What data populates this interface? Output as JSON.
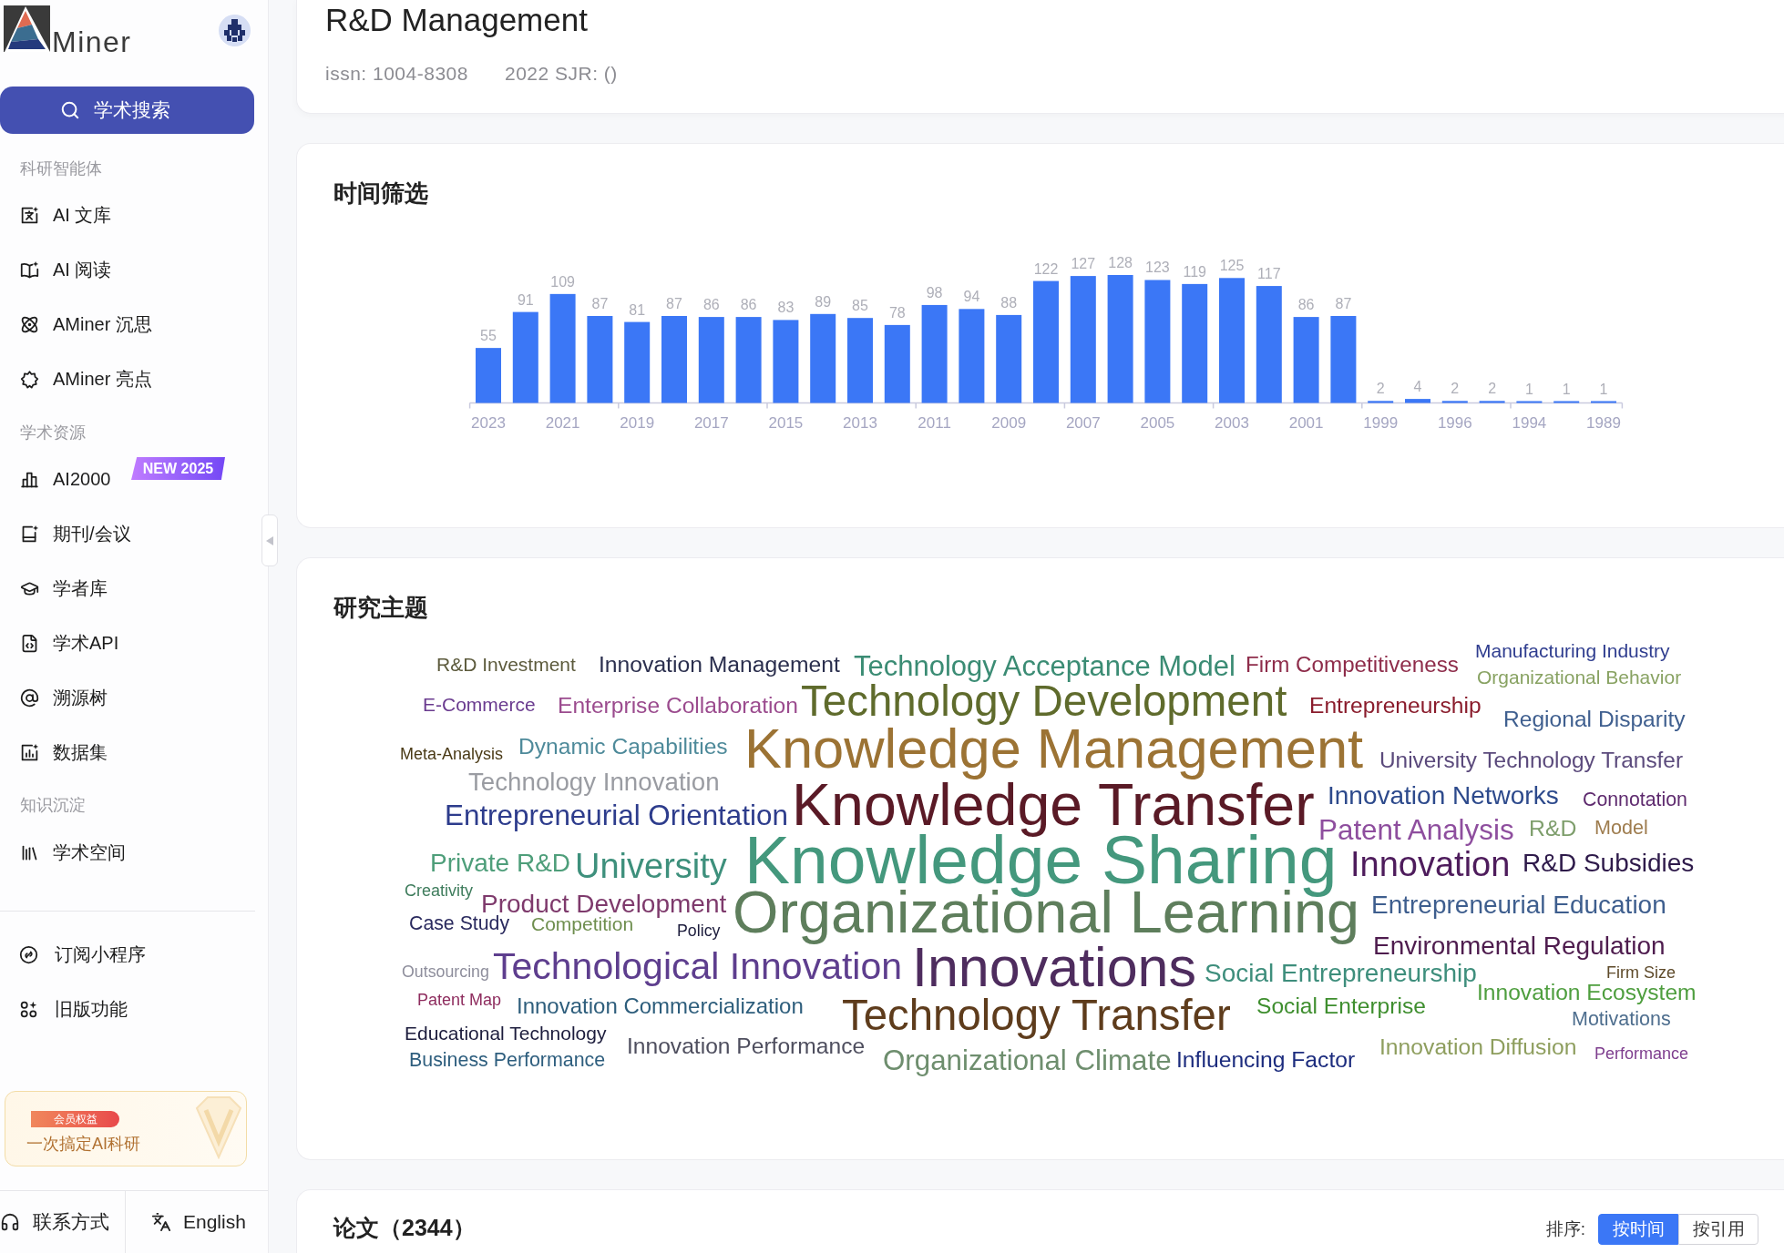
{
  "sidebar": {
    "logo_text": "Miner",
    "search_button": "学术搜索",
    "sections": [
      {
        "title": "科研智能体",
        "items": [
          {
            "label": "AI 文库",
            "selected": false
          },
          {
            "label": "AI 阅读",
            "selected": false
          },
          {
            "label": "AMiner 沉思",
            "selected": false
          },
          {
            "label": "AMiner 亮点",
            "selected": false
          }
        ]
      },
      {
        "title": "学术资源",
        "items": [
          {
            "label": "AI2000",
            "badge": "NEW 2025",
            "selected": false
          },
          {
            "label": "期刊/会议",
            "selected": false
          },
          {
            "label": "学者库",
            "selected": false
          },
          {
            "label": "学术API",
            "selected": false
          },
          {
            "label": "溯源树",
            "selected": false
          },
          {
            "label": "数据集",
            "selected": false
          }
        ]
      },
      {
        "title": "知识沉淀",
        "items": [
          {
            "label": "学术空间",
            "selected": false
          }
        ]
      }
    ],
    "extra_items": [
      {
        "label": "订阅小程序",
        "selected": false
      },
      {
        "label": "旧版功能",
        "selected": false
      }
    ],
    "promo": {
      "badge": "会员权益",
      "text": "一次搞定AI科研"
    },
    "footer": [
      "联系方式",
      "English"
    ]
  },
  "journal": {
    "title": "R&D Management",
    "issn": "issn: 1004-8308",
    "sjr": "2022 SJR: ()"
  },
  "time_filter": {
    "title": "时间筛选",
    "chart_data": {
      "type": "bar",
      "categories": [
        "2023",
        null,
        "2021",
        null,
        "2019",
        null,
        "2017",
        null,
        "2015",
        null,
        "2013",
        null,
        "2011",
        null,
        "2009",
        null,
        "2007",
        null,
        "2005",
        null,
        "2003",
        null,
        "2001",
        null,
        "1999",
        null,
        "1996",
        null,
        "1994",
        null,
        "1989"
      ],
      "values": [
        55,
        91,
        109,
        87,
        81,
        87,
        86,
        86,
        83,
        89,
        85,
        78,
        98,
        94,
        88,
        122,
        127,
        128,
        123,
        119,
        125,
        117,
        86,
        87,
        2,
        4,
        2,
        2,
        1,
        1,
        1
      ],
      "data_labels": true
    }
  },
  "topics": {
    "title": "研究主题",
    "words": [
      {
        "text": "R&D Investment",
        "color": "#5c5a3c"
      },
      {
        "text": "Innovation Management",
        "color": "#2b2f4e"
      },
      {
        "text": "Technology Acceptance Model",
        "color": "#3b8c74"
      },
      {
        "text": "Firm Competitiveness",
        "color": "#8e2c4a"
      },
      {
        "text": "Manufacturing Industry",
        "color": "#2f3d8f"
      },
      {
        "text": "Organizational Behavior",
        "color": "#88a262"
      },
      {
        "text": "E-Commerce",
        "color": "#6a3b8f"
      },
      {
        "text": "Enterprise Collaboration",
        "color": "#9b4b8e"
      },
      {
        "text": "Technology Development",
        "color": "#5f6b2c"
      },
      {
        "text": "Entrepreneurship",
        "color": "#8a1c2c"
      },
      {
        "text": "Regional Disparity",
        "color": "#3f5f8f"
      },
      {
        "text": "Meta-Analysis",
        "color": "#4a3a16"
      },
      {
        "text": "Dynamic Capabilities",
        "color": "#4e8a9a"
      },
      {
        "text": "Knowledge Management",
        "color": "#9c7334"
      },
      {
        "text": "University Technology Transfer",
        "color": "#5b4a7c"
      },
      {
        "text": "Technology Innovation",
        "color": "#9a9ca2"
      },
      {
        "text": "Entrepreneurial Orientation",
        "color": "#2d3c8c"
      },
      {
        "text": "Knowledge Transfer",
        "color": "#5a1a26"
      },
      {
        "text": "Innovation Networks",
        "color": "#2d4a8c"
      },
      {
        "text": "Connotation",
        "color": "#5e2a6e"
      },
      {
        "text": "Patent Analysis",
        "color": "#8e4e9e"
      },
      {
        "text": "R&D",
        "color": "#7e9e6c"
      },
      {
        "text": "Model",
        "color": "#9e7c4e"
      },
      {
        "text": "Private R&D",
        "color": "#4e9e7a"
      },
      {
        "text": "University",
        "color": "#3e907c"
      },
      {
        "text": "Knowledge Sharing",
        "color": "#44987d"
      },
      {
        "text": "Innovation",
        "color": "#4e1c5c"
      },
      {
        "text": "R&D Subsidies",
        "color": "#2e1a4a"
      },
      {
        "text": "Creativity",
        "color": "#3e7c5c"
      },
      {
        "text": "Product Development",
        "color": "#7e3a6c"
      },
      {
        "text": "Organizational Learning",
        "color": "#5e7e5c"
      },
      {
        "text": "Entrepreneurial Education",
        "color": "#3e5e8e"
      },
      {
        "text": "Case Study",
        "color": "#2a2a5e"
      },
      {
        "text": "Competition",
        "color": "#6e8e4e"
      },
      {
        "text": "Policy",
        "color": "#1c1c3c"
      },
      {
        "text": "Environmental Regulation",
        "color": "#4e1c4e"
      },
      {
        "text": "Outsourcing",
        "color": "#8e8e9c"
      },
      {
        "text": "Technological Innovation",
        "color": "#5e3e8e"
      },
      {
        "text": "Innovations",
        "color": "#4e2c5e"
      },
      {
        "text": "Social Entrepreneurship",
        "color": "#3e8e7c"
      },
      {
        "text": "Firm Size",
        "color": "#5e4a2a"
      },
      {
        "text": "Patent Map",
        "color": "#8e2c5e"
      },
      {
        "text": "Innovation Commercialization",
        "color": "#2e5e7c"
      },
      {
        "text": "Technology Transfer",
        "color": "#5e3c1c"
      },
      {
        "text": "Social Enterprise",
        "color": "#3e8e2e"
      },
      {
        "text": "Innovation Ecosystem",
        "color": "#4e9e3e"
      },
      {
        "text": "Educational Technology",
        "color": "#1c1c3c"
      },
      {
        "text": "Motivations",
        "color": "#4e6e8e"
      },
      {
        "text": "Innovation Performance",
        "color": "#4e4e5e"
      },
      {
        "text": "Innovation Diffusion",
        "color": "#8e9e5e"
      },
      {
        "text": "Business Performance",
        "color": "#2e5e7e"
      },
      {
        "text": "Organizational Climate",
        "color": "#6e8e6e"
      },
      {
        "text": "Influencing Factor",
        "color": "#1c2c7e"
      },
      {
        "text": "Performance",
        "color": "#7e3e8e"
      }
    ]
  },
  "papers": {
    "title": "论文（2344）",
    "sort_label": "排序:",
    "sort_options": [
      {
        "label": "按时间",
        "selected": true
      },
      {
        "label": "按引用",
        "selected": false
      }
    ]
  }
}
